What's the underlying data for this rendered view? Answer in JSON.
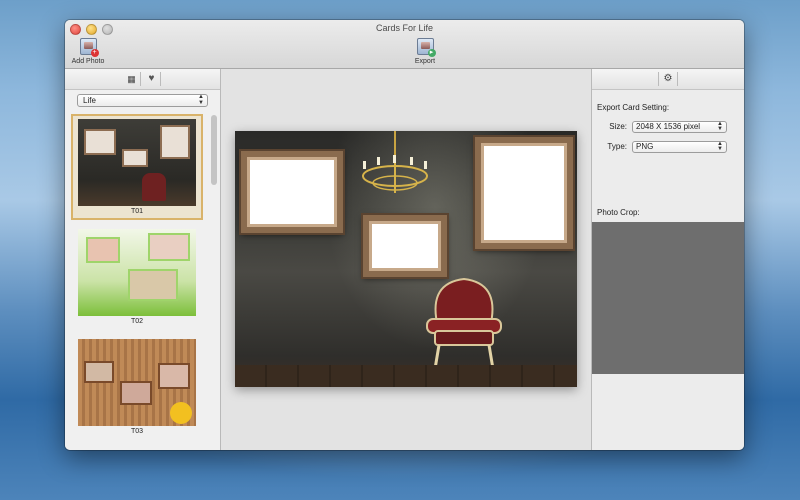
{
  "window": {
    "title": "Cards For Life"
  },
  "toolbar": {
    "add_photo_label": "Add Photo",
    "export_label": "Export"
  },
  "left_panel": {
    "tabs": [
      {
        "icon": "grid-icon"
      },
      {
        "icon": "heart-icon"
      }
    ],
    "category": "Life",
    "templates": [
      {
        "name": "T01",
        "selected": true
      },
      {
        "name": "T02",
        "selected": false
      },
      {
        "name": "T03",
        "selected": false
      }
    ]
  },
  "right_panel": {
    "settings_icon": "gear-icon",
    "section_title": "Export Card Setting:",
    "size_label": "Size:",
    "size_value": "2048 X 1536 pixel",
    "type_label": "Type:",
    "type_value": "PNG",
    "crop_label": "Photo Crop:"
  },
  "colors": {
    "selection_border": "#d9b36a",
    "crop_area": "#6e6e6e",
    "frame_gold": "#8a6b4e"
  }
}
